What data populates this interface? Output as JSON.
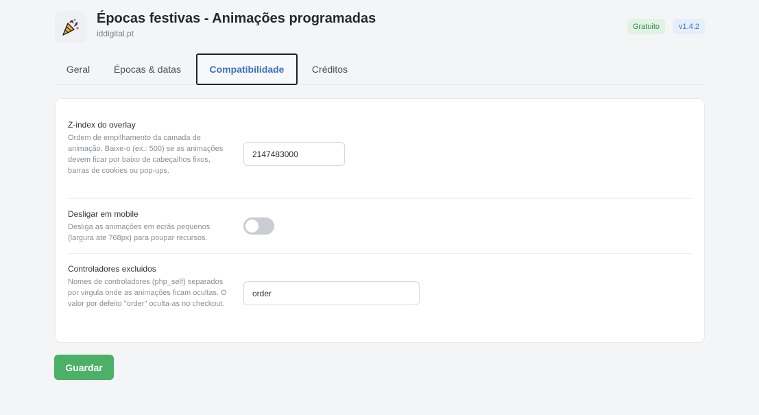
{
  "header": {
    "title": "Épocas festivas - Animações programadas",
    "subtitle": "iddigital.pt",
    "logo_icon": "party-popper-icon",
    "badges": {
      "free": "Gratuito",
      "version": "v1.4.2"
    }
  },
  "tabs": [
    {
      "label": "Geral"
    },
    {
      "label": "Épocas & datas"
    },
    {
      "label": "Compatibilidade",
      "active": true
    },
    {
      "label": "Créditos"
    }
  ],
  "settings": {
    "zindex": {
      "label": "Z-index do overlay",
      "description": "Ordem de empilhamento da camada de animação. Baixe-o (ex.: 500) se as animações devem ficar por baixo de cabeçalhos fixos, barras de cookies ou pop-ups.",
      "value": "2147483000"
    },
    "mobile": {
      "label": "Desligar em mobile",
      "description": "Desliga as animações em ecrãs pequenos (largura ate 768px) para poupar recursos.",
      "enabled": false
    },
    "controllers": {
      "label": "Controladores excluidos",
      "description": "Nomes de controladores (php_self) separados por virgula onde as animações ficam ocultas. O valor por defeito \"order\" oculta-as no checkout.",
      "value": "order"
    }
  },
  "actions": {
    "save_label": "Guardar"
  },
  "colors": {
    "accent": "#3b74c4",
    "save": "#4cb066",
    "badge_free": "#2e8b47",
    "toggle_off": "#c9ccd2"
  }
}
